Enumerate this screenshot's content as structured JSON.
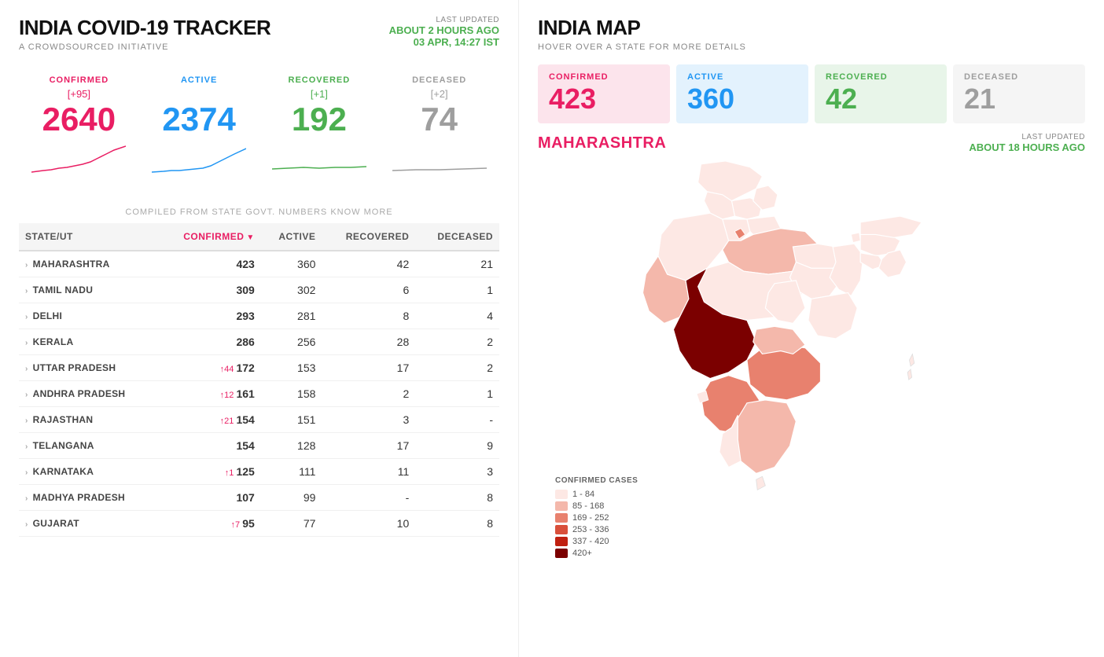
{
  "header": {
    "title": "INDIA COVID-19 TRACKER",
    "subtitle": "A CROWDSOURCED INITIATIVE",
    "last_updated_label": "LAST UPDATED",
    "last_updated_time": "ABOUT 2 HOURS AGO",
    "last_updated_date": "03 APR, 14:27 IST"
  },
  "national_stats": {
    "confirmed": {
      "label": "CONFIRMED",
      "delta": "[+95]",
      "value": "2640"
    },
    "active": {
      "label": "ACTIVE",
      "delta": "",
      "value": "2374"
    },
    "recovered": {
      "label": "RECOVERED",
      "delta": "[+1]",
      "value": "192"
    },
    "deceased": {
      "label": "DECEASED",
      "delta": "[+2]",
      "value": "74"
    }
  },
  "table": {
    "note": "COMPILED FROM STATE GOVT. NUMBERS KNOW MORE",
    "headers": {
      "state": "STATE/UT",
      "confirmed": "CONFIRMED",
      "active": "ACTIVE",
      "recovered": "RECOVERED",
      "deceased": "DECEASED"
    },
    "rows": [
      {
        "state": "MAHARASHTRA",
        "delta": "",
        "confirmed": "423",
        "active": "360",
        "recovered": "42",
        "deceased": "21"
      },
      {
        "state": "TAMIL NADU",
        "delta": "",
        "confirmed": "309",
        "active": "302",
        "recovered": "6",
        "deceased": "1"
      },
      {
        "state": "DELHI",
        "delta": "",
        "confirmed": "293",
        "active": "281",
        "recovered": "8",
        "deceased": "4"
      },
      {
        "state": "KERALA",
        "delta": "",
        "confirmed": "286",
        "active": "256",
        "recovered": "28",
        "deceased": "2"
      },
      {
        "state": "UTTAR PRADESH",
        "delta": "↑44",
        "confirmed": "172",
        "active": "153",
        "recovered": "17",
        "deceased": "2"
      },
      {
        "state": "ANDHRA PRADESH",
        "delta": "↑12",
        "confirmed": "161",
        "active": "158",
        "recovered": "2",
        "deceased": "1"
      },
      {
        "state": "RAJASTHAN",
        "delta": "↑21",
        "confirmed": "154",
        "active": "151",
        "recovered": "3",
        "deceased": "-"
      },
      {
        "state": "TELANGANA",
        "delta": "",
        "confirmed": "154",
        "active": "128",
        "recovered": "17",
        "deceased": "9"
      },
      {
        "state": "KARNATAKA",
        "delta": "↑1",
        "confirmed": "125",
        "active": "111",
        "recovered": "11",
        "deceased": "3"
      },
      {
        "state": "MADHYA PRADESH",
        "delta": "",
        "confirmed": "107",
        "active": "99",
        "recovered": "-",
        "deceased": "8"
      },
      {
        "state": "GUJARAT",
        "delta": "↑7",
        "confirmed": "95",
        "active": "77",
        "recovered": "10",
        "deceased": "8"
      }
    ]
  },
  "map": {
    "title": "INDIA MAP",
    "subtitle": "HOVER OVER A STATE FOR MORE DETAILS",
    "selected_state": "MAHARASHTRA",
    "last_updated_label": "LAST UPDATED",
    "last_updated_time": "ABOUT 18 HOURS AGO",
    "confirmed": {
      "label": "CONFIRMED",
      "value": "423"
    },
    "active": {
      "label": "ACTIVE",
      "value": "360"
    },
    "recovered": {
      "label": "RECOVERED",
      "value": "42"
    },
    "deceased": {
      "label": "DECEASED",
      "value": "21"
    }
  },
  "legend": {
    "title": "CONFIRMED CASES",
    "items": [
      {
        "range": "1 - 84",
        "color": "#fde8e4"
      },
      {
        "range": "85 - 168",
        "color": "#f4b8ab"
      },
      {
        "range": "169 - 252",
        "color": "#e8816e"
      },
      {
        "range": "253 - 336",
        "color": "#d94f3a"
      },
      {
        "range": "337 - 420",
        "color": "#c02010"
      },
      {
        "range": "420+",
        "color": "#7b0000"
      }
    ]
  }
}
